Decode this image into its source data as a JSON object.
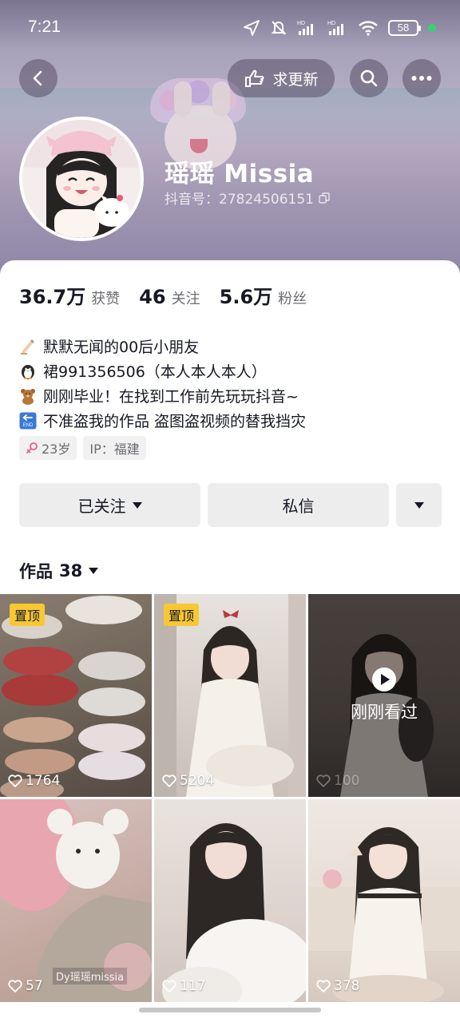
{
  "status_bar": {
    "time": "7:21",
    "battery": "58",
    "hd1": "HD",
    "hd2": "HD"
  },
  "nav": {
    "update_label": "求更新"
  },
  "profile": {
    "nickname": "瑶瑶 Missia",
    "douyin_id": "抖音号：27824506151"
  },
  "stats": [
    {
      "value": "36.7万",
      "label": "获赞"
    },
    {
      "value": "46",
      "label": "关注"
    },
    {
      "value": "5.6万",
      "label": "粉丝"
    }
  ],
  "bio": [
    {
      "icon": "writing-hand-icon",
      "text": "默默无闻的00后小朋友"
    },
    {
      "icon": "penguin-icon",
      "text": "裙991356506（本人本人本人）"
    },
    {
      "icon": "teddy-bear-icon",
      "text": "刚刚毕业！在找到工作前先玩玩抖音~"
    },
    {
      "icon": "end-arrow-icon",
      "text": "不准盗我的作品 盗图盗视频的替我挡灾"
    }
  ],
  "tags": {
    "age": "23岁",
    "ip": "IP：福建"
  },
  "actions": {
    "follow": "已关注",
    "message": "私信"
  },
  "works": {
    "label": "作品",
    "count": "38"
  },
  "grid": [
    {
      "pinned": "置顶",
      "likes": "1764",
      "watched": ""
    },
    {
      "pinned": "置顶",
      "likes": "5204",
      "watched": ""
    },
    {
      "pinned": "",
      "likes": "100",
      "watched": "刚刚看过"
    },
    {
      "pinned": "",
      "likes": "57",
      "watched": "",
      "watermark": "Dy瑶瑶missia"
    },
    {
      "pinned": "",
      "likes": "117",
      "watched": ""
    },
    {
      "pinned": "",
      "likes": "378",
      "watched": ""
    }
  ],
  "colors": {
    "pin": "#f8c833",
    "text": "#161823",
    "secondary": "#6b6c72",
    "button_bg": "#ededee"
  }
}
